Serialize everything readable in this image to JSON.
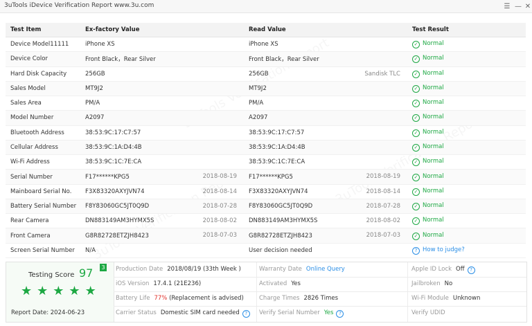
{
  "window": {
    "title": "3uTools iDevice Verification Report www.3u.com"
  },
  "table": {
    "headers": [
      "Test Item",
      "Ex-factory Value",
      "Read Value",
      "Test Result"
    ],
    "rows": [
      {
        "item": "Device Model11111",
        "ex": "iPhone XS",
        "ex_date": "",
        "read": "iPhone XS",
        "read_date": "",
        "result": "Normal"
      },
      {
        "item": "Device Color",
        "ex": "Front Black，Rear Silver",
        "ex_date": "",
        "read": "Front Black，Rear Silver",
        "read_date": "",
        "result": "Normal"
      },
      {
        "item": "Hard Disk Capacity",
        "ex": "256GB",
        "ex_date": "",
        "read": "256GB",
        "read_date": "Sandisk TLC",
        "result": "Normal"
      },
      {
        "item": "Sales Model",
        "ex": "MT9J2",
        "ex_date": "",
        "read": "MT9J2",
        "read_date": "",
        "result": "Normal"
      },
      {
        "item": "Sales Area",
        "ex": "PM/A",
        "ex_date": "",
        "read": "PM/A",
        "read_date": "",
        "result": "Normal"
      },
      {
        "item": "Model Number",
        "ex": "A2097",
        "ex_date": "",
        "read": "A2097",
        "read_date": "",
        "result": "Normal"
      },
      {
        "item": "Bluetooth Address",
        "ex": "38:53:9C:17:C7:57",
        "ex_date": "",
        "read": "38:53:9C:17:C7:57",
        "read_date": "",
        "result": "Normal"
      },
      {
        "item": "Cellular Address",
        "ex": "38:53:9C:1A:D4:4B",
        "ex_date": "",
        "read": "38:53:9C:1A:D4:4B",
        "read_date": "",
        "result": "Normal"
      },
      {
        "item": "Wi-Fi Address",
        "ex": "38:53:9C:1C:7E:CA",
        "ex_date": "",
        "read": "38:53:9C:1C:7E:CA",
        "read_date": "",
        "result": "Normal"
      },
      {
        "item": "Serial Number",
        "ex": "F17******KPG5",
        "ex_date": "2018-08-19",
        "read": "F17******KPG5",
        "read_date": "2018-08-19",
        "result": "Normal"
      },
      {
        "item": "Mainboard Serial No.",
        "ex": "F3X83320AXYJVN74",
        "ex_date": "2018-08-14",
        "read": "F3X83320AXYJVN74",
        "read_date": "2018-08-14",
        "result": "Normal"
      },
      {
        "item": "Battery Serial Number",
        "ex": "F8Y83060GC5JT0Q9D",
        "ex_date": "2018-07-28",
        "read": "F8Y83060GC5JT0Q9D",
        "read_date": "2018-07-28",
        "result": "Normal"
      },
      {
        "item": "Rear Camera",
        "ex": "DN883149AM3HYMX5S",
        "ex_date": "2018-08-02",
        "read": "DN883149AM3HYMX5S",
        "read_date": "2018-08-02",
        "result": "Normal"
      },
      {
        "item": "Front Camera",
        "ex": "G8R82728ETZJH8423",
        "ex_date": "2018-07-03",
        "read": "G8R82728ETZJH8423",
        "read_date": "2018-07-03",
        "result": "Normal"
      },
      {
        "item": "Screen Serial Number",
        "ex": "N/A",
        "ex_date": "",
        "read": "User decision needed",
        "read_date": "",
        "result": "How to judge?"
      }
    ]
  },
  "summary": {
    "testing_score_label": "Testing Score",
    "testing_score": "97",
    "badge": "3",
    "stars": 5,
    "report_date_label": "Report Date:",
    "report_date": "2024-06-23",
    "production_date_label": "Production Date",
    "production_date": "2018/08/19 (33th Week )",
    "ios_version_label": "iOS Version",
    "ios_version": "17.4.1 (21E236)",
    "battery_life_label": "Battery Life",
    "battery_life_pct": "77%",
    "battery_life_note": "(Replacement is advised)",
    "carrier_status_label": "Carrier Status",
    "carrier_status": "Domestic SIM card needed",
    "warranty_date_label": "Warranty Date",
    "warranty_date": "Online Query",
    "activated_label": "Activated",
    "activated": "Yes",
    "charge_times_label": "Charge Times",
    "charge_times": "2826 Times",
    "verify_serial_label": "Verify Serial Number",
    "verify_serial": "Yes",
    "apple_id_lock_label": "Apple ID Lock",
    "apple_id_lock": "Off",
    "jailbroken_label": "Jailbroken",
    "jailbroken": "No",
    "wifi_module_label": "Wi-Fi Module",
    "wifi_module": "Unknown",
    "verify_udid_label": "Verify UDID"
  },
  "colors": {
    "green": "#1da843",
    "blue": "#2a8ee6",
    "red": "#e0302a"
  }
}
